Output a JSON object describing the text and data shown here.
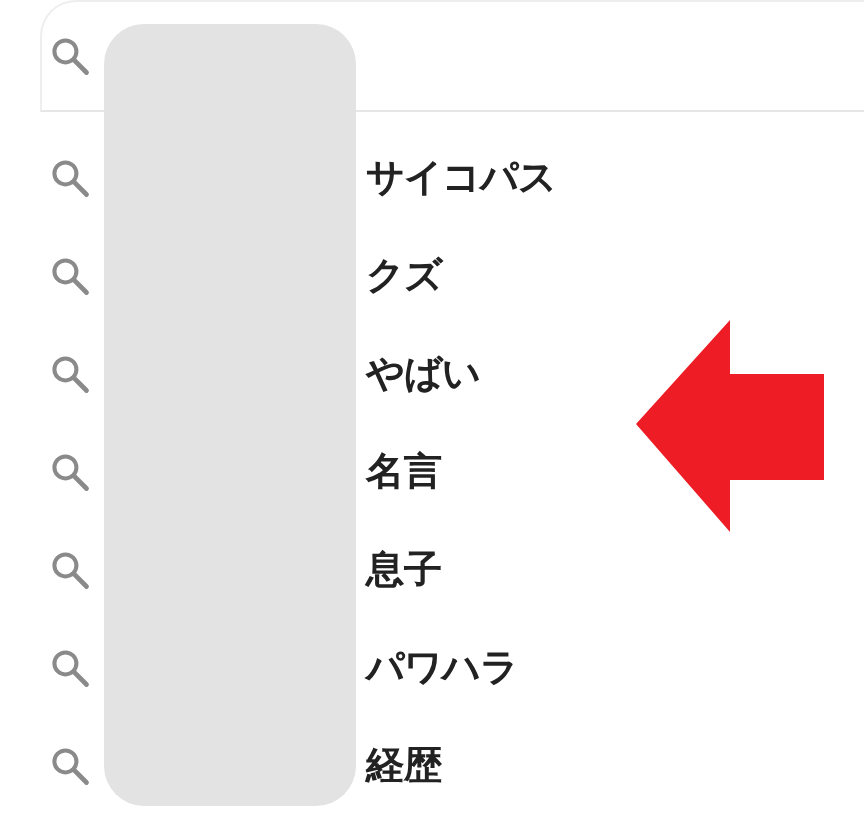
{
  "suggestions": [
    {
      "text": "サイコパス"
    },
    {
      "text": "クズ"
    },
    {
      "text": "やばい"
    },
    {
      "text": "名言"
    },
    {
      "text": "息子"
    },
    {
      "text": "パワハラ"
    },
    {
      "text": "経歴"
    }
  ]
}
